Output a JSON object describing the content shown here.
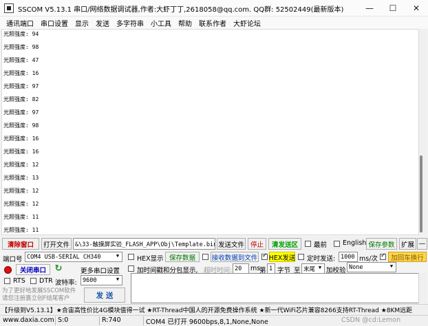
{
  "window": {
    "title": "SSCOM V5.13.1 串口/网络数据调试器,作者:大虾丁丁,2618058@qq.com. QQ群: 52502449(最新版本)",
    "minimize": "—",
    "maximize": "☐",
    "close": "✕"
  },
  "menu": [
    "通讯端口",
    "串口设置",
    "显示",
    "发送",
    "多字符串",
    "小工具",
    "帮助",
    "联系作者",
    "大虾论坛"
  ],
  "receive_lines": [
    "光照强度: 94",
    "光照强度: 98",
    "光照强度: 47",
    "光照强度: 16",
    "光照强度: 97",
    "光照强度: 82",
    "光照强度: 97",
    "光照强度: 98",
    "光照强度: 16",
    "光照强度: 16",
    "光照强度: 12",
    "光照强度: 13",
    "光照强度: 12",
    "光照强度: 12",
    "光照强度: 11",
    "光照强度: 11"
  ],
  "toolbar": {
    "clear_window": "清除窗口",
    "open_file": "打开文件",
    "file_path": "&\\33-触摸屏实验_FLASH_APP\\Obj\\Template.bin",
    "send_file": "发送文件",
    "stop": "停止",
    "clear_send": "清发送区",
    "front": "最前",
    "english": "English",
    "save_params": "保存参数",
    "expand": "扩展",
    "collapse": "—"
  },
  "port": {
    "port_label": "端口号",
    "port_value": "COM4 USB-SERIAL CH340",
    "close_port": "关闭串口",
    "more_settings": "更多串口设置",
    "rts": "RTS",
    "dtr": "DTR",
    "baud_label": "波特率:",
    "baud_value": "9600",
    "promo": "为了更好地发展SSCOM软件\n请您注册嘉立创F结尾客户"
  },
  "options": {
    "hex_display": "HEX显示",
    "save_data": "保存数据",
    "recv_to_file": "接收数据到文件",
    "hex_send": "HEX发送",
    "timed_send": "定时发送:",
    "interval": "1000",
    "interval_unit": "ms/次",
    "add_crlf": "加回车换行",
    "timestamp": "加时间戳和分包显示,",
    "timeout_label": "超时时间:",
    "timeout_value": "20",
    "timeout_unit": "ms",
    "byte_no": "第",
    "byte_value": "1",
    "byte_label": "字节",
    "to": "至",
    "end": "末尾",
    "checksum": "加校验",
    "checksum_value": "None",
    "send": "发 送"
  },
  "ticker": "【升级到V5.13.1】★合宙高性价比4G模块值得一试 ★RT-Thread中国人的开源免费操作系统 ★新一代WiFi芯片兼容8266支持RT-Thread ★8KM远距",
  "status": {
    "site": "www.daxia.com",
    "sent": "S:0",
    "recv": "R:740",
    "port_state": "COM4 已打开  9600bps,8,1,None,None",
    "watermark": "CSDN @cd:Lemon"
  },
  "colors": {
    "accent_green": "#1e8f1e",
    "warning_red": "#c00000",
    "hex_highlight": "#ffff00",
    "crlf_highlight": "#ffd54a"
  }
}
